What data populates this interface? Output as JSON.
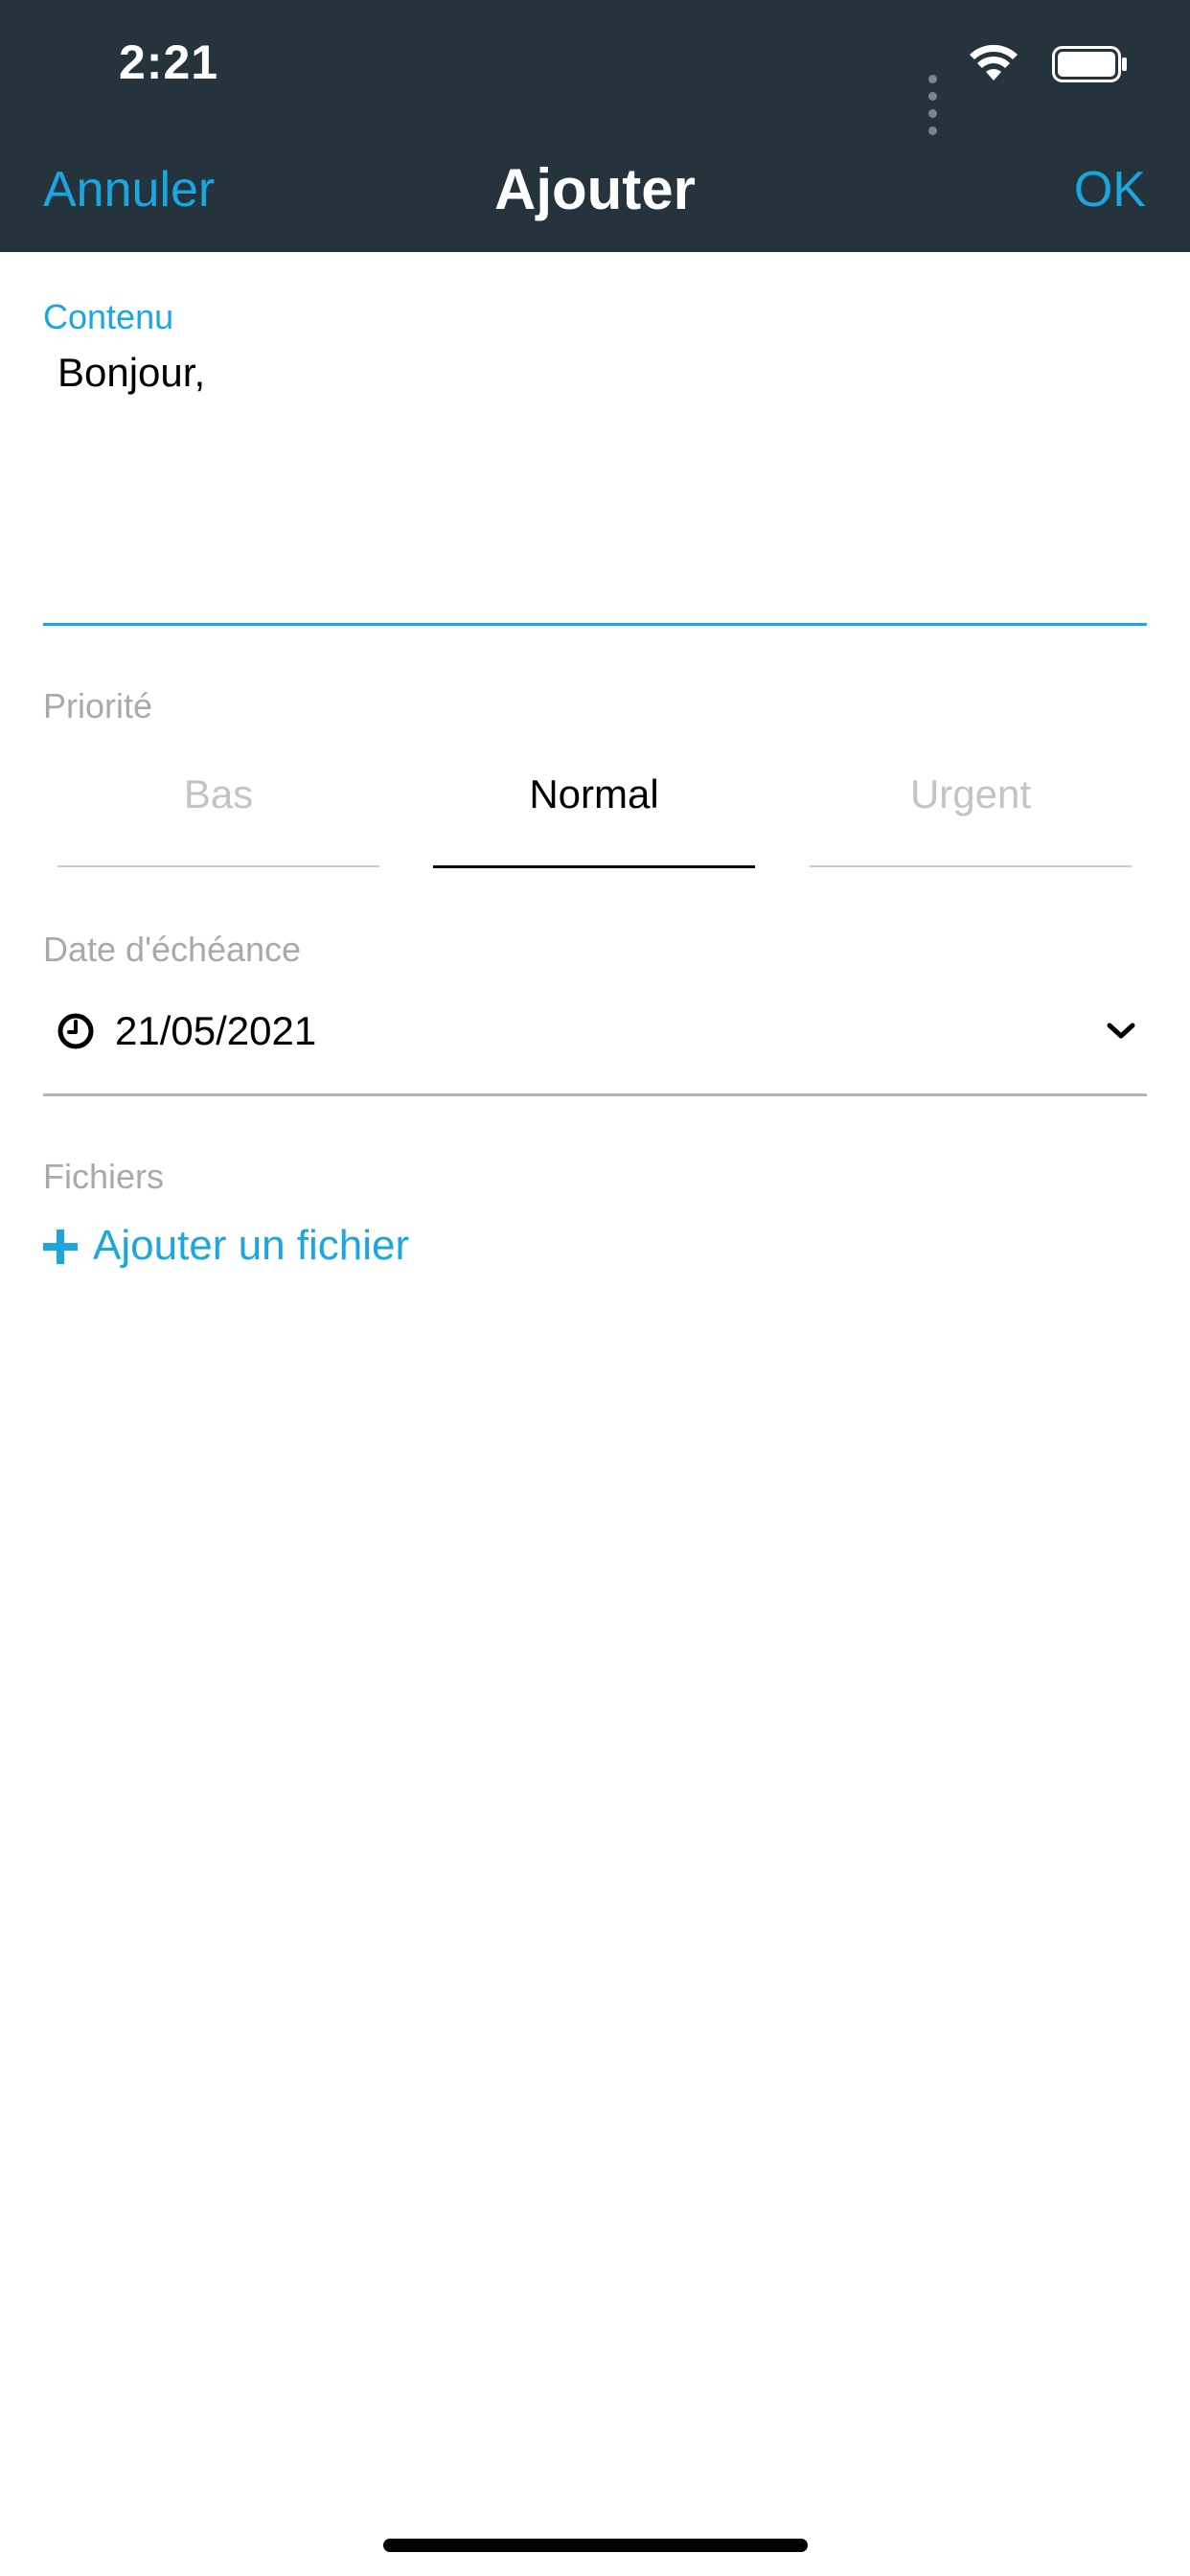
{
  "status_bar": {
    "time": "2:21"
  },
  "nav": {
    "cancel": "Annuler",
    "title": "Ajouter",
    "ok": "OK"
  },
  "content": {
    "label": "Contenu",
    "value": "Bonjour,"
  },
  "priority": {
    "label": "Priorité",
    "options": [
      "Bas",
      "Normal",
      "Urgent"
    ],
    "selected": "Normal"
  },
  "due_date": {
    "label": "Date d'échéance",
    "value": "21/05/2021"
  },
  "files": {
    "label": "Fichiers",
    "add_label": "Ajouter un fichier"
  },
  "colors": {
    "accent": "#1ba6df",
    "header_bg": "#24333c",
    "muted": "#a7a9ab"
  },
  "icons": {
    "clock": "clock-icon",
    "chevron": "chevron-down-icon",
    "plus": "plus-icon",
    "wifi": "wifi-icon",
    "battery": "battery-icon"
  }
}
